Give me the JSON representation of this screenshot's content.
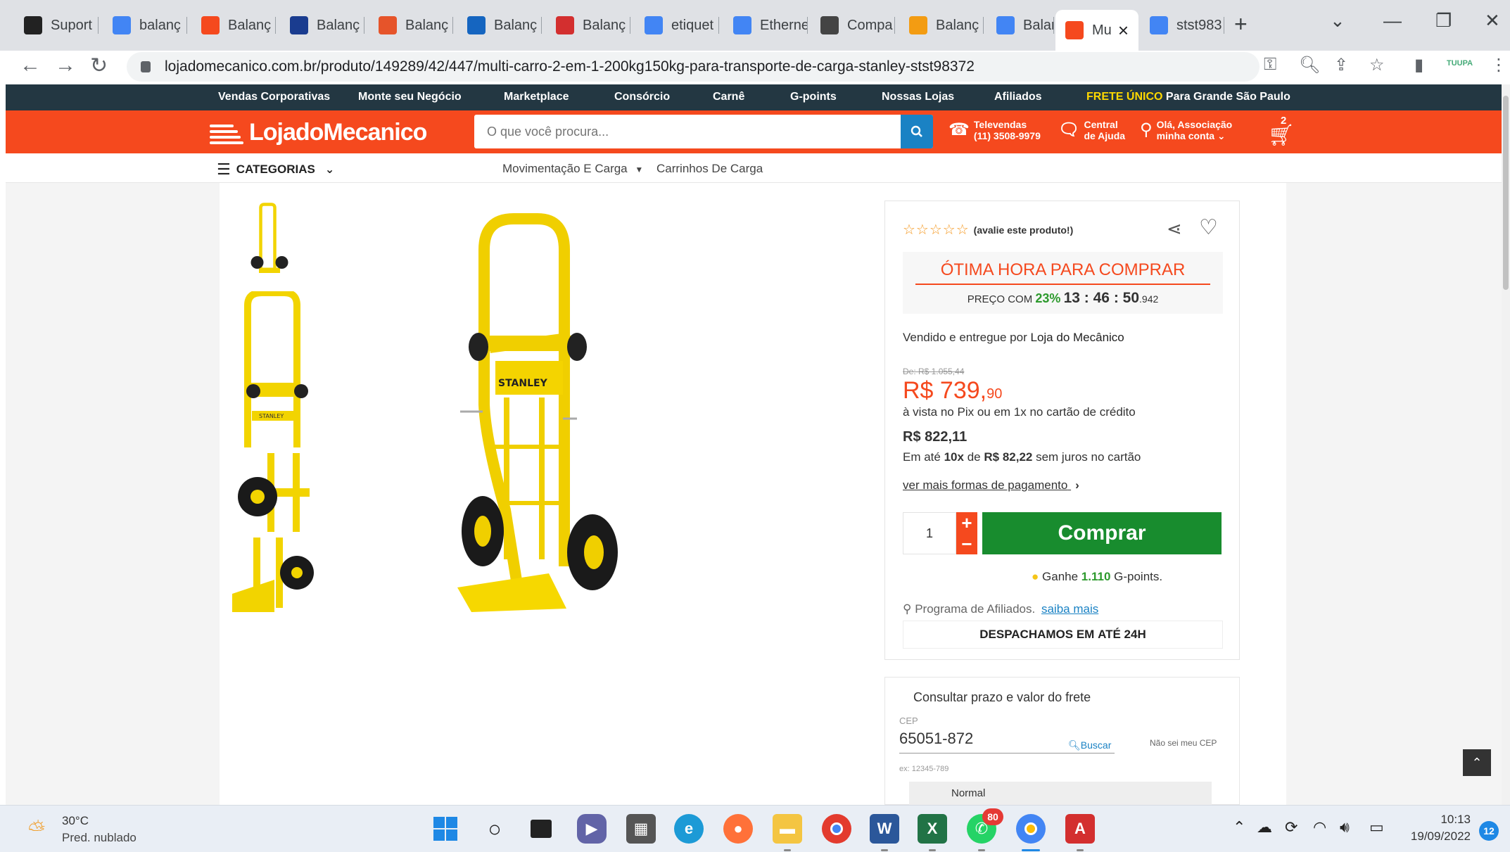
{
  "browser": {
    "tabs": [
      {
        "label": "Suport",
        "icon": "support-icon",
        "color": "#222222"
      },
      {
        "label": "balanç",
        "icon": "google-icon",
        "color": "#4285f4"
      },
      {
        "label": "Balanç",
        "icon": "store-icon",
        "color": "#f5491e"
      },
      {
        "label": "Balanç",
        "icon": "b-icon",
        "color": "#1a3c8f"
      },
      {
        "label": "Balanç",
        "icon": "pen-icon",
        "color": "#e6542a"
      },
      {
        "label": "Balanç",
        "icon": "ship-icon",
        "color": "#1565c0"
      },
      {
        "label": "Balanç",
        "icon": "a-icon",
        "color": "#d32f2f"
      },
      {
        "label": "etiquet",
        "icon": "google-icon",
        "color": "#4285f4"
      },
      {
        "label": "Etherne",
        "icon": "google-icon",
        "color": "#4285f4"
      },
      {
        "label": "Compa",
        "icon": "globe-icon",
        "color": "#444444"
      },
      {
        "label": "Balanç",
        "icon": "coin-icon",
        "color": "#f39c12"
      },
      {
        "label": "Balanç",
        "icon": "google-icon",
        "color": "#4285f4"
      },
      {
        "label": "Mu",
        "icon": "store-icon",
        "color": "#f5491e",
        "active": true
      },
      {
        "label": "stst983",
        "icon": "google-icon",
        "color": "#4285f4"
      }
    ],
    "new_tab": "+",
    "url": "lojadomecanico.com.br/produto/149289/42/447/multi-carro-2-em-1-200kg150kg-para-transporte-de-carga-stanley-stst98372",
    "profile_label": "TUUPA"
  },
  "site": {
    "topbar": {
      "links": [
        "Vendas Corporativas",
        "Monte seu Negócio",
        "Marketplace",
        "Consórcio",
        "Carnê",
        "G-points",
        "Nossas Lojas",
        "Afiliados"
      ],
      "frete_highlight": "FRETE ÚNICO",
      "frete_rest": " Para Grande São Paulo"
    },
    "header": {
      "logo": "LojadoMecanico",
      "search_placeholder": "O que você procura...",
      "televendas_l1": "Televendas",
      "televendas_l2": "(11) 3508-9979",
      "central_l1": "Central",
      "central_l2": "de Ajuda",
      "account_l1": "Olá, Associação",
      "account_l2": "minha conta ⌄",
      "cart_count": "2"
    },
    "catbar": {
      "categories": "CATEGORIAS",
      "crumb1": "Movimentação E Carga",
      "crumb2": "Carrinhos De Carga"
    }
  },
  "product": {
    "brand_on_image": "STANLEY",
    "rating_text": "(avalie este produto!)",
    "promo_title": "ÓTIMA HORA PARA COMPRAR",
    "promo_prefix": "PREÇO COM",
    "promo_pct": "23%",
    "promo_timer": "13 : 46 : 50",
    "promo_ms": ".942",
    "sold_by_prefix": "Vendido e entregue por",
    "sold_by": "Loja do Mecânico",
    "old_price": "De: R$ 1.055,44",
    "price_main": "R$ 739,",
    "price_cents": "90",
    "price_note": "à vista no Pix ou em 1x no cartão de crédito",
    "card_price": "R$ 822,11",
    "installments_prefix": "Em até",
    "installments_n": "10x",
    "installments_mid": "de",
    "installments_value": "R$ 82,22",
    "installments_suffix": "sem juros no cartão",
    "payment_link": "ver mais formas de pagamento",
    "quantity": "1",
    "qty_plus": "+",
    "qty_minus": "−",
    "buy_label": "Comprar",
    "gpoints_prefix": "Ganhe",
    "gpoints_value": "1.110",
    "gpoints_suffix": "G-points.",
    "affiliates_text": "Programa de Afiliados.",
    "affiliates_link": "saiba mais",
    "dispatch_prefix": "DESPACHAMOS EM",
    "dispatch_time": "ATÉ 24H"
  },
  "freight": {
    "title": "Consultar prazo e valor do frete",
    "cep_label": "CEP",
    "cep_value": "65051-872",
    "search_btn": "Buscar",
    "dont_know": "Não sei meu CEP",
    "example": "ex: 12345-789",
    "option": "Normal"
  },
  "taskbar": {
    "weather_temp": "30°C",
    "weather_desc": "Pred. nublado",
    "whatsapp_badge": "80",
    "time": "10:13",
    "date": "19/09/2022",
    "notif_count": "12"
  },
  "colors": {
    "brand_orange": "#f5491e",
    "topbar_navy": "#233742",
    "buy_green": "#188c2e",
    "discount_green": "#2d9a2d",
    "link_blue": "#1a82c4"
  }
}
